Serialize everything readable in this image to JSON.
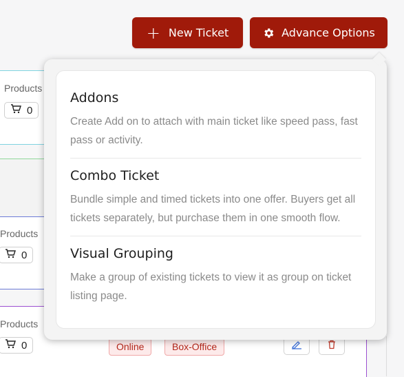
{
  "toolbar": {
    "new_ticket_label": "New Ticket",
    "advance_options_label": "Advance Options"
  },
  "advance_menu": {
    "options": [
      {
        "title": "Addons",
        "description": "Create Add on to attach with main ticket like speed pass, fast pass or activity."
      },
      {
        "title": "Combo Ticket",
        "description": "Bundle simple and timed tickets into one offer. Buyers get all tickets separately, but purchase them in one smooth flow."
      },
      {
        "title": "Visual Grouping",
        "description": "Make a group of existing tickets to view it as group on ticket listing page."
      }
    ]
  },
  "ticket_rows": [
    {
      "products_label": "Products",
      "cart_count": "0"
    },
    {
      "products_label": "Products",
      "cart_count": "0"
    },
    {
      "products_label": "Products",
      "cart_count": "0"
    }
  ],
  "row_tags": [
    "Online",
    "Box-Office"
  ],
  "colors": {
    "primary_button": "#a01a0a",
    "tag_text": "#b3271b",
    "tag_bg": "#fdeaea"
  },
  "icons": {
    "new_ticket": "plus-icon",
    "advance_options": "gear-icon",
    "cart": "cart-icon",
    "edit": "edit-icon",
    "delete": "trash-icon"
  }
}
